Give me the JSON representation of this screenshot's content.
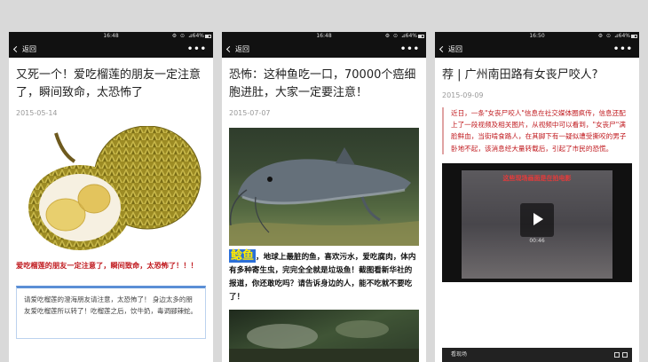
{
  "phones": [
    {
      "status": {
        "time": "16:48",
        "battery": "64%"
      },
      "nav": {
        "back_label": "返回",
        "more_label": "•••"
      },
      "title": "又死一个！爱吃榴莲的朋友一定注意了，瞬间致命，太恐怖了",
      "date": "2015-05-14",
      "red_caption": "爱吃榴莲的朋友一定注意了，瞬间致命，太恐怖了！！！",
      "quote": "请爱吃榴莲的澄海朋友请注意，太恐怖了！ 身边太多的朋友爱吃榴莲所以转了！吃榴莲之后，饮牛奶，毒调郦辣蛇。"
    },
    {
      "status": {
        "time": "16:48",
        "battery": "64%"
      },
      "nav": {
        "back_label": "返回",
        "more_label": "•••"
      },
      "title": "恐怖：这种鱼吃一口，70000个癌细胞进肚，大家一定要注意！",
      "date": "2015-07-07",
      "highlight": "鲶鱼",
      "body": "，地球上最脏的鱼，喜欢污水，爱吃腐肉，体内有多种寄生虫，完完全全就是垃圾鱼！截图看新华社的报道，你还敢吃吗？请告诉身边的人，能不吃就不要吃了！"
    },
    {
      "status": {
        "time": "16:50",
        "battery": "64%"
      },
      "nav": {
        "back_label": "返回",
        "more_label": "•••"
      },
      "title": "荐 | 广州南田路有女丧尸咬人?",
      "date": "2015-09-09",
      "quote": "近日，一条\"女丧尸咬人\"信息在社交媒体圈疯传，信息还配上了一段视频及相关图片，从视频中可以看到，\"女丧尸\"满脸鲜血，当街啃食路人，在其脚下有一疑似遭受撕咬的男子卧地不起，该消息经大量转载后，引起了市民的恐慌。",
      "video": {
        "caption": "这些现场画面是在拍电影",
        "duration": "00:46"
      },
      "mini_bar_label": "看现场"
    }
  ]
}
